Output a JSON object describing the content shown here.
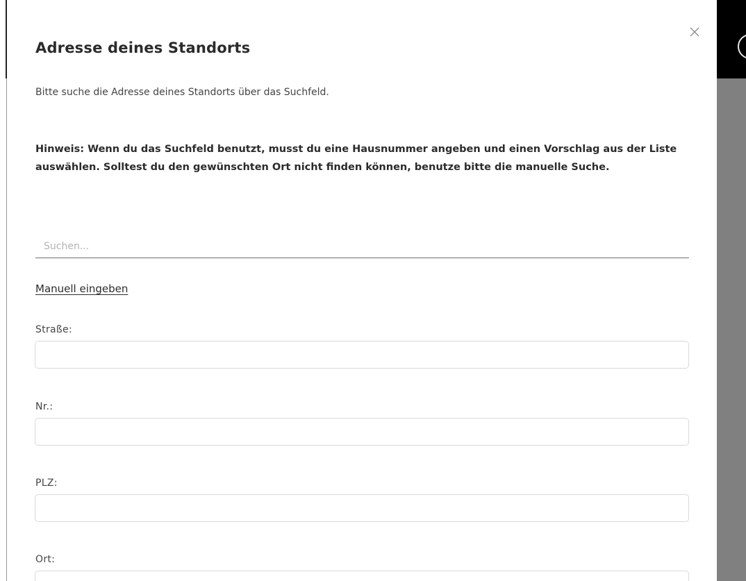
{
  "modal": {
    "title": "Adresse deines Standorts",
    "intro": "Bitte suche die Adresse deines Standorts über das Suchfeld.",
    "notice": "Hinweis: Wenn du das Suchfeld benutzt, musst du eine Hausnummer angeben und einen Vorschlag aus der Liste auswählen. Solltest du den gewünschten Ort nicht finden können, benutze bitte die manuelle Suche.",
    "search": {
      "placeholder": "Suchen...",
      "value": ""
    },
    "manual_link": "Manuell eingeben",
    "fields": [
      {
        "label": "Straße:",
        "value": ""
      },
      {
        "label": "Nr.:",
        "value": ""
      },
      {
        "label": "PLZ:",
        "value": ""
      },
      {
        "label": "Ort:",
        "value": ""
      }
    ],
    "close_icon": "close-icon"
  },
  "colors": {
    "text": "#2b2b2b",
    "border": "#d9d9d9",
    "backdrop": "#808080",
    "header": "#000000"
  }
}
